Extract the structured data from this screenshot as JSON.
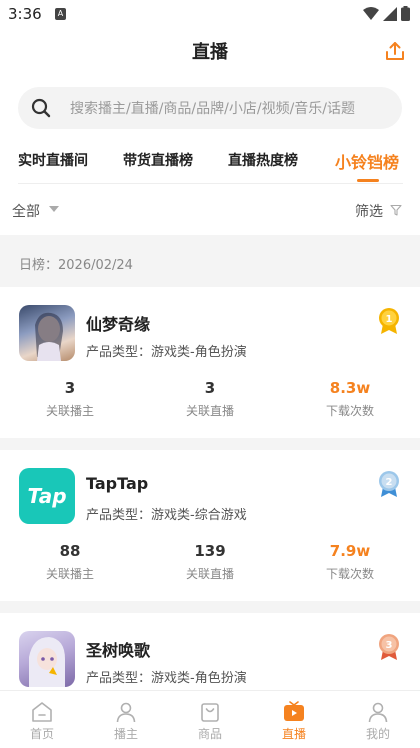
{
  "status_bar": {
    "time": "3:36",
    "app_icon_letter": "A"
  },
  "header": {
    "title": "直播",
    "share_icon": "share-icon"
  },
  "search": {
    "placeholder": "搜索播主/直播/商品/品牌/小店/视频/音乐/话题"
  },
  "tabs": [
    {
      "label": "实时直播间",
      "active": false
    },
    {
      "label": "带货直播榜",
      "active": false
    },
    {
      "label": "直播热度榜",
      "active": false
    },
    {
      "label": "小铃铛榜",
      "active": true
    }
  ],
  "filters": {
    "category": "全部",
    "screen": "筛选"
  },
  "date_label": "日榜：2026/02/24",
  "stat_labels": {
    "streamers": "关联播主",
    "lives": "关联直播",
    "downloads": "下载次数"
  },
  "items": [
    {
      "rank": "1",
      "name": "仙梦奇缘",
      "type": "产品类型：游戏类-角色扮演",
      "streamers": "3",
      "lives": "3",
      "downloads": "8.3w",
      "rank_color": "#f5b400"
    },
    {
      "rank": "2",
      "name": "TapTap",
      "type": "产品类型：游戏类-综合游戏",
      "streamers": "88",
      "lives": "139",
      "downloads": "7.9w",
      "rank_color": "#5aa8e0",
      "logo_text": "Tap"
    },
    {
      "rank": "3",
      "name": "圣树唤歌",
      "type": "产品类型：游戏类-角色扮演",
      "streamers": "",
      "lives": "",
      "downloads": "",
      "rank_color": "#e8835a"
    }
  ],
  "tabbar": [
    {
      "label": "首页",
      "icon": "home-icon",
      "active": false
    },
    {
      "label": "播主",
      "icon": "person-icon",
      "active": false
    },
    {
      "label": "商品",
      "icon": "bag-icon",
      "active": false
    },
    {
      "label": "直播",
      "icon": "tv-icon",
      "active": true
    },
    {
      "label": "我的",
      "icon": "profile-icon",
      "active": false
    }
  ],
  "colors": {
    "accent": "#f5821f",
    "taptap": "#19c7b8"
  }
}
